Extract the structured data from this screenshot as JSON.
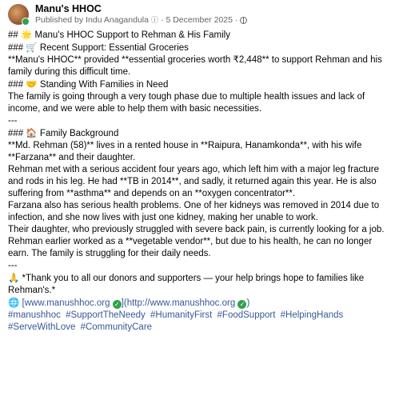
{
  "header": {
    "page_name": "Manu's HHOC",
    "published_by_label": "Published by",
    "author": "Indu Anagandula",
    "separator": "·",
    "date": "5 December 2025"
  },
  "post": {
    "h1_prefix": "##",
    "h1_emoji": "🌟",
    "h1_text": "Manu's HHOC Support to Rehman & His Family",
    "h3a_prefix": "###",
    "h3a_emoji": "🛒",
    "h3a_text": "Recent Support: Essential Groceries",
    "p1": "**Manu's HHOC** provided **essential groceries worth ₹2,448** to support Rehman and his family during this difficult time.",
    "h3b_prefix": "###",
    "h3b_emoji": "🤝",
    "h3b_text": "Standing With Families in Need",
    "p2": "The family is going through a very tough phase due to multiple health issues and lack of income, and we were able to help them with basic necessities.",
    "divider1": "---",
    "h3c_prefix": "###",
    "h3c_emoji": "🏠",
    "h3c_text": "Family Background",
    "p3": "**Md. Rehman (58)** lives in a rented house in **Raipura, Hanamkonda**, with his wife **Farzana** and their daughter.",
    "p4": "Rehman met with a serious accident four years ago, which left him with a major leg fracture and rods in his leg. He had **TB in 2014**, and sadly, it returned again this year. He is also suffering from **asthma** and depends on an **oxygen concentrator**.",
    "p5a": "Farzana also has serious health problems. One of her kidneys was removed in 2014 due to infection, and she now lives with just one kidney, making her unable to work.",
    "p5b": "Their daughter, who previously struggled with severe back pain, is currently looking for a job.",
    "p6": "Rehman earlier worked as a **vegetable vendor**, but due to his health, he can no longer earn. The family is struggling for their daily needs.",
    "divider2": "---",
    "thanks_emoji": "🙏",
    "thanks": "*Thank you to all our donors and supporters — your help brings hope to families like Rehman's.*",
    "link_emoji": "🌐",
    "link_open": "[",
    "link_text1": "www.manushhoc.org",
    "link_mid": "](http://www.manushhoc.org",
    "link_close": ")",
    "hashtags": [
      "#manushhoc",
      "#SupportTheNeedy",
      "#HumanityFirst",
      "#FoodSupport",
      "#HelpingHands",
      "#ServeWithLove",
      "#CommunityCare"
    ]
  }
}
